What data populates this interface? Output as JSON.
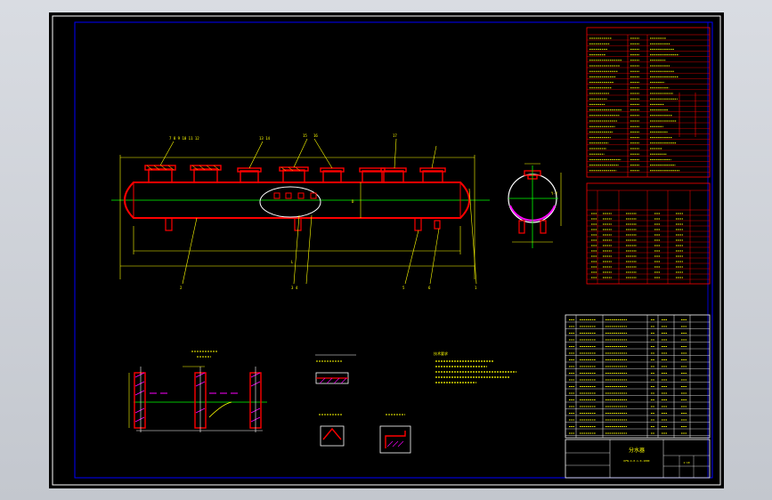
{
  "drawing": {
    "title_block": {
      "name": "分水器",
      "code": "DFN-4.0-1.0-1000",
      "scale": "1:10"
    },
    "notes_heading": "技术要求",
    "colors": {
      "frame": "#ffffff",
      "border": "#0000ff",
      "vessel": "#ff0000",
      "centerline": "#00ff00",
      "dimension": "#ffff00",
      "text": "#ffff00",
      "accent": "#ff00ff",
      "table": "#ff0000"
    }
  }
}
